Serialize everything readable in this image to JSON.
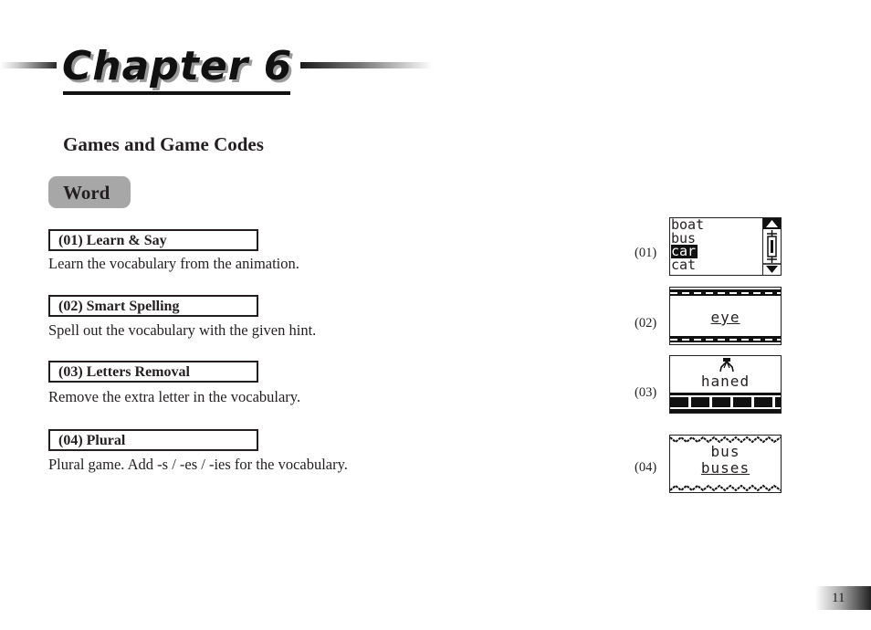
{
  "chapter": {
    "title": "Chapter 6"
  },
  "section": {
    "heading": "Games and Game Codes"
  },
  "category": {
    "label": "Word"
  },
  "games": [
    {
      "code_title": "(01) Learn & Say",
      "description": "Learn the vocabulary from the animation."
    },
    {
      "code_title": "(02) Smart Spelling",
      "description": "Spell out the vocabulary with the given hint."
    },
    {
      "code_title": "(03) Letters Removal",
      "description": "Remove the extra letter in the vocabulary."
    },
    {
      "code_title": "(04) Plural",
      "description": "Plural game. Add -s / -es / -ies for the vocabulary."
    }
  ],
  "screens": [
    {
      "label": "(01)",
      "words": [
        "boat",
        "bus",
        "car",
        "cat"
      ],
      "selected_index": 2
    },
    {
      "label": "(02)",
      "word": "eye"
    },
    {
      "label": "(03)",
      "word": "haned",
      "icon": "claw-icon"
    },
    {
      "label": "(04)",
      "singular": "bus",
      "plural": "buses"
    }
  ],
  "page": {
    "number": "11"
  }
}
